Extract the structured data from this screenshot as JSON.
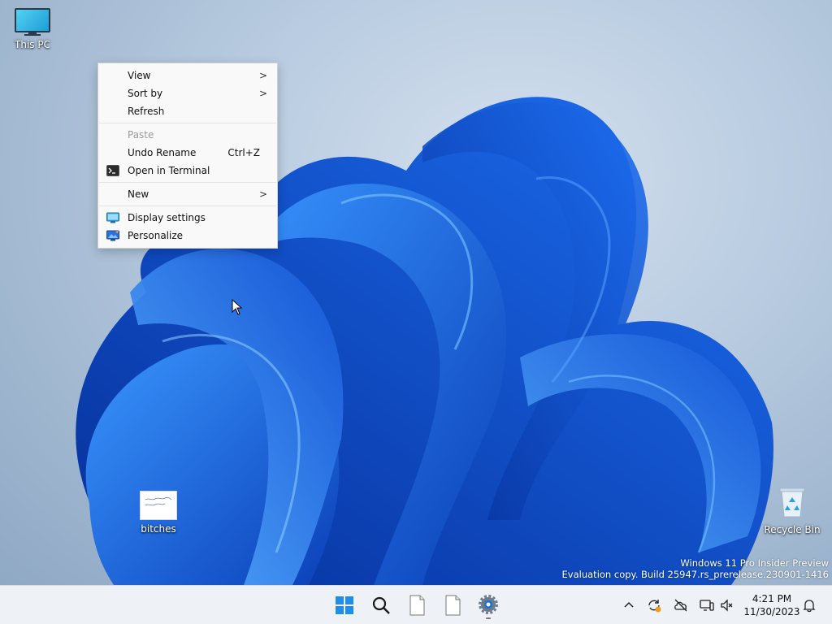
{
  "desktop": {
    "icons": [
      {
        "label": "This PC",
        "icon": "monitor-icon"
      },
      {
        "label": "bitches",
        "icon": "image-thumbnail-icon"
      },
      {
        "label": "Recycle Bin",
        "icon": "recycle-bin-icon"
      }
    ],
    "watermark": {
      "line1": "Windows 11 Pro Insider Preview",
      "line2": "Evaluation copy. Build 25947.rs_prerelease.230901-1416"
    }
  },
  "context_menu": {
    "items": [
      {
        "label": "View",
        "has_submenu": true
      },
      {
        "label": "Sort by",
        "has_submenu": true
      },
      {
        "label": "Refresh"
      },
      {
        "label": "Paste",
        "disabled": true
      },
      {
        "label": "Undo Rename",
        "shortcut": "Ctrl+Z"
      },
      {
        "label": "Open in Terminal",
        "icon": "terminal-icon"
      },
      {
        "label": "New",
        "has_submenu": true
      },
      {
        "label": "Display settings",
        "icon": "display-icon"
      },
      {
        "label": "Personalize",
        "icon": "personalize-icon"
      }
    ],
    "submenu_arrow": ">"
  },
  "taskbar": {
    "buttons": [
      "start-icon",
      "search-icon",
      "file-icon",
      "file-icon",
      "settings-icon"
    ],
    "tray": [
      "chevron-up-icon",
      "sync-icon",
      "cloud-offline-icon",
      "network-icon",
      "volume-muted-icon"
    ],
    "clock": {
      "time": "4:21 PM",
      "date": "11/30/2023"
    }
  },
  "colors": {
    "accent": "#0067c0",
    "wallpaper_dark": "#0a3fb8",
    "wallpaper_light": "#2f8cff"
  }
}
